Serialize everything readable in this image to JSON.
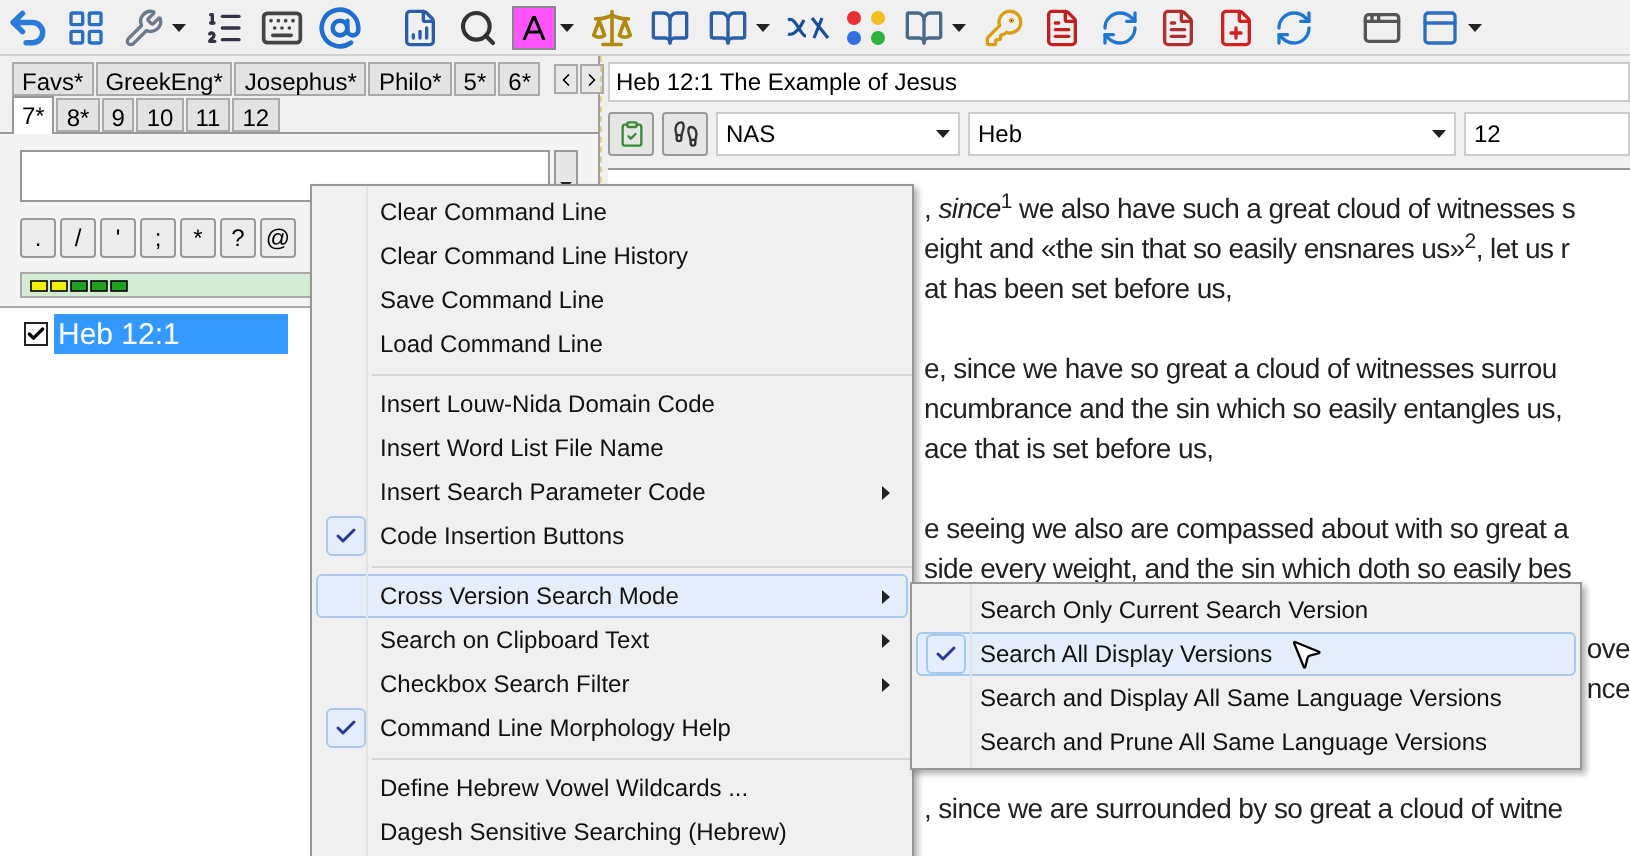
{
  "left_panel": {
    "tab_rows": [
      [
        {
          "label": "Favs*",
          "selected": false
        },
        {
          "label": "GreekEng*",
          "selected": false
        },
        {
          "label": "Josephus*",
          "selected": false
        },
        {
          "label": "Philo*",
          "selected": false
        },
        {
          "label": "5*",
          "selected": false
        },
        {
          "label": "6*",
          "selected": false
        }
      ],
      [
        {
          "label": "7*",
          "selected": true
        },
        {
          "label": "8*",
          "selected": false
        },
        {
          "label": "9",
          "selected": false
        },
        {
          "label": "10",
          "selected": false
        },
        {
          "label": "11",
          "selected": false
        },
        {
          "label": "12",
          "selected": false
        }
      ]
    ],
    "code_buttons": [
      ".",
      "/",
      "'",
      ";",
      "*",
      "?",
      "@"
    ],
    "tree": [
      {
        "label": "Heb 12:1",
        "checked": true,
        "selected": true
      }
    ]
  },
  "passage": {
    "title": "Heb 12:1 The Example of Jesus",
    "version": "NAS",
    "book": "Heb",
    "chapter": "12",
    "lines": [
      {
        "kind": "text",
        "text": ", *since*$^{1}$ we also have such a great cloud of witnesses s"
      },
      {
        "kind": "text",
        "text": "eight and «the sin that so easily ensnares us»$^{2}$, let us r"
      },
      {
        "kind": "text",
        "text": "at has been set before us,"
      },
      {
        "kind": "gap"
      },
      {
        "kind": "text",
        "text": "e, since we have so great a cloud of witnesses surrou"
      },
      {
        "kind": "text",
        "text": "ncumbrance and the sin which so easily entangles us,"
      },
      {
        "kind": "text",
        "text": "ace that is set before us,"
      },
      {
        "kind": "gap"
      },
      {
        "kind": "text",
        "text": "e seeing we also are compassed about with so great a"
      },
      {
        "kind": "text",
        "text": "side every weight, and the sin which doth so easily bes"
      },
      {
        "kind": "gap"
      },
      {
        "kind": "tail",
        "text": "ove"
      },
      {
        "kind": "tail",
        "text": "nce"
      },
      {
        "kind": "gap"
      },
      {
        "kind": "gap"
      },
      {
        "kind": "text",
        "text": ", since we are surrounded by so great a cloud of witne"
      }
    ]
  },
  "context_menu": {
    "items": [
      {
        "kind": "item",
        "label": "Clear Command Line",
        "checked": false,
        "submenu": false,
        "selected": false
      },
      {
        "kind": "item",
        "label": "Clear Command Line History",
        "checked": false,
        "submenu": false,
        "selected": false
      },
      {
        "kind": "item",
        "label": "Save Command Line",
        "checked": false,
        "submenu": false,
        "selected": false
      },
      {
        "kind": "item",
        "label": "Load Command Line",
        "checked": false,
        "submenu": false,
        "selected": false
      },
      {
        "kind": "separator"
      },
      {
        "kind": "item",
        "label": "Insert Louw-Nida Domain Code",
        "checked": false,
        "submenu": false,
        "selected": false
      },
      {
        "kind": "item",
        "label": "Insert Word List File Name",
        "checked": false,
        "submenu": false,
        "selected": false
      },
      {
        "kind": "item",
        "label": "Insert Search Parameter Code",
        "checked": false,
        "submenu": true,
        "selected": false
      },
      {
        "kind": "item",
        "label": "Code Insertion Buttons",
        "checked": true,
        "submenu": false,
        "selected": false
      },
      {
        "kind": "separator"
      },
      {
        "kind": "item",
        "label": "Cross Version Search Mode",
        "checked": false,
        "submenu": true,
        "selected": true
      },
      {
        "kind": "item",
        "label": "Search on Clipboard Text",
        "checked": false,
        "submenu": true,
        "selected": false
      },
      {
        "kind": "item",
        "label": "Checkbox Search Filter",
        "checked": false,
        "submenu": true,
        "selected": false
      },
      {
        "kind": "item",
        "label": "Command Line Morphology Help",
        "checked": true,
        "submenu": false,
        "selected": false
      },
      {
        "kind": "separator"
      },
      {
        "kind": "item",
        "label": "Define Hebrew Vowel Wildcards ...",
        "checked": false,
        "submenu": false,
        "selected": false
      },
      {
        "kind": "item",
        "label": "Dagesh Sensitive Searching (Hebrew)",
        "checked": false,
        "submenu": false,
        "selected": false
      }
    ]
  },
  "submenu": {
    "items": [
      {
        "label": "Search Only Current Search Version",
        "checked": false,
        "selected": false
      },
      {
        "label": "Search All Display Versions",
        "checked": true,
        "selected": true
      },
      {
        "label": "Search and Display All Same Language Versions",
        "checked": false,
        "selected": false
      },
      {
        "label": "Search and Prune All Same Language Versions",
        "checked": false,
        "selected": false
      }
    ]
  }
}
